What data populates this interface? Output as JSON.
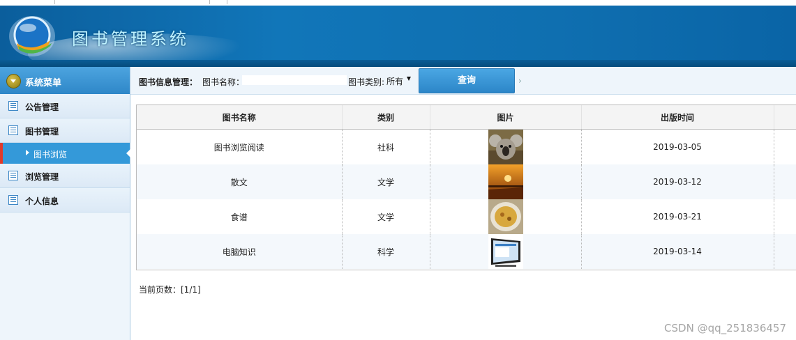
{
  "header": {
    "title": "图书管理系统"
  },
  "sidebar": {
    "heading": "系统菜单",
    "items": [
      {
        "label": "公告管理"
      },
      {
        "label": "图书管理"
      },
      {
        "label": "图书浏览",
        "active": true,
        "sub": true
      },
      {
        "label": "浏览管理"
      },
      {
        "label": "个人信息"
      }
    ]
  },
  "toolbar": {
    "section_label": "图书信息管理：",
    "name_label": "图书名称：",
    "name_value": "",
    "category_label": "图书类别:",
    "category_value": "所有",
    "query_button": "查询"
  },
  "table": {
    "columns": [
      "图书名称",
      "类别",
      "图片",
      "出版时间"
    ],
    "rows": [
      {
        "name": "图书浏览阅读",
        "category": "社科",
        "image": "koala-photo",
        "date": "2019-03-05"
      },
      {
        "name": "散文",
        "category": "文学",
        "image": "sunset-pier-photo",
        "date": "2019-03-12"
      },
      {
        "name": "食谱",
        "category": "文学",
        "image": "food-bowl-photo",
        "date": "2019-03-21"
      },
      {
        "name": "电脑知识",
        "category": "科学",
        "image": "monitor-photo",
        "date": "2019-03-14"
      }
    ]
  },
  "pager": {
    "text": "当前页数：[1/1]"
  },
  "watermark": "CSDN @qq_251836457",
  "colors": {
    "accent": "#2e87c8",
    "header": "#0f6fb0",
    "active_marker": "#e03a2a"
  }
}
